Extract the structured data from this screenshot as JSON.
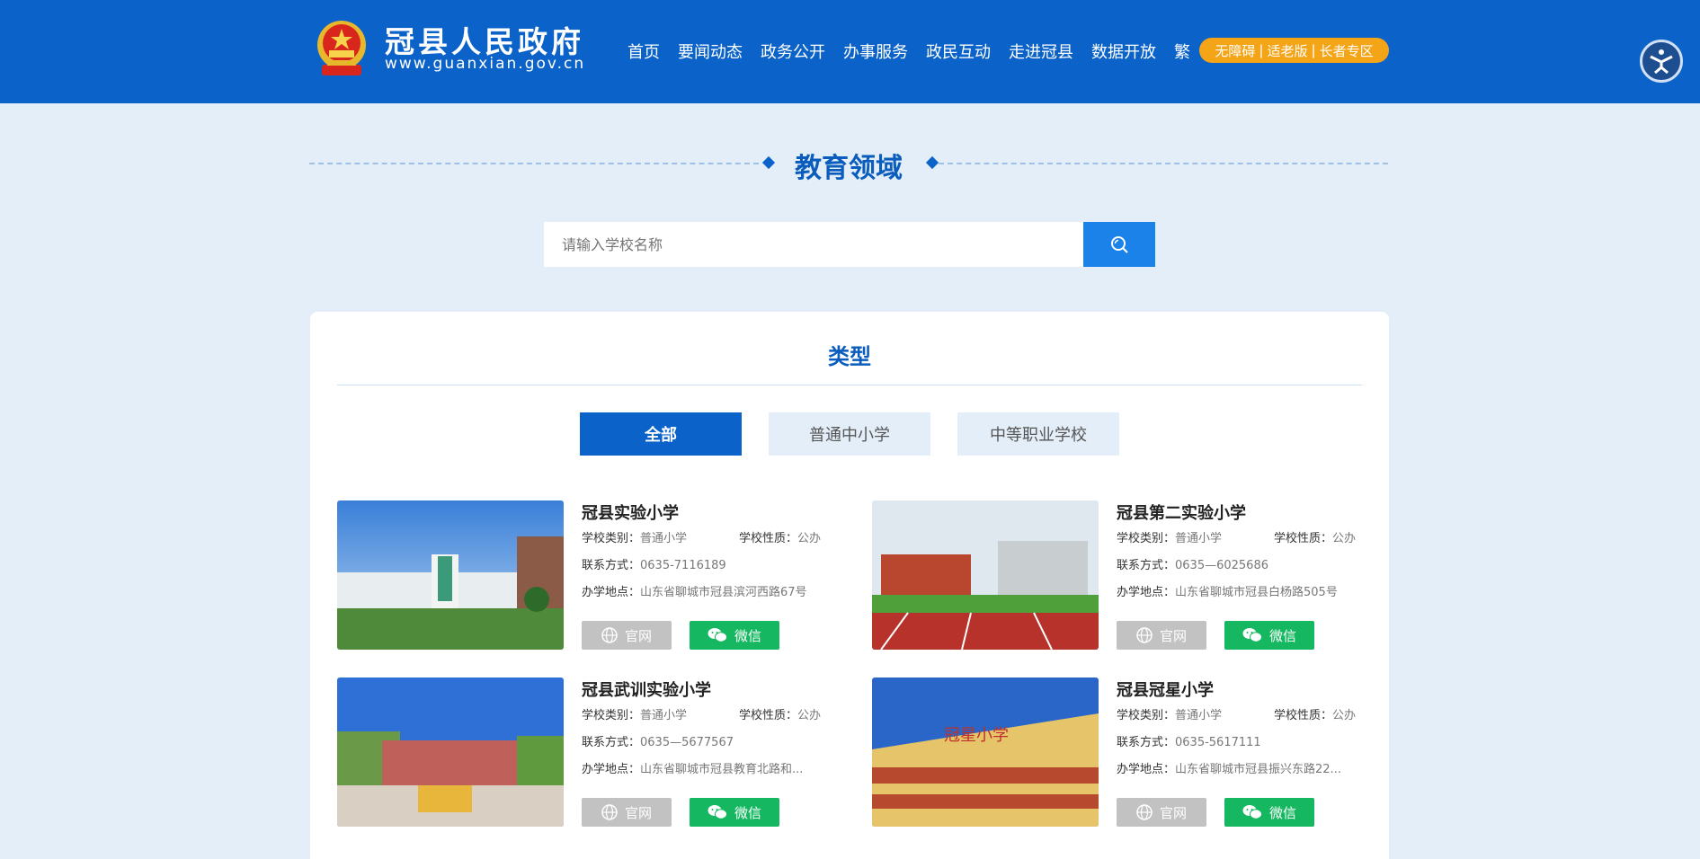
{
  "header": {
    "site_title": "冠县人民政府",
    "site_domain": "www.guanxian.gov.cn",
    "nav": [
      "首页",
      "要闻动态",
      "政务公开",
      "办事服务",
      "政民互动",
      "走进冠县",
      "数据开放",
      "繁"
    ],
    "accessibility": [
      "无障碍",
      "适老版",
      "长者专区"
    ],
    "separator": "|"
  },
  "section": {
    "title": "教育领域"
  },
  "search": {
    "placeholder": "请输入学校名称"
  },
  "panel": {
    "title": "类型",
    "tabs": [
      "全部",
      "普通中小学",
      "中等职业学校"
    ],
    "active_tab": "全部"
  },
  "labels": {
    "category": "学校类别：",
    "nature": "学校性质：",
    "contact": "联系方式：",
    "address": "办学地点：",
    "website": "官网",
    "wechat": "微信"
  },
  "schools": [
    {
      "name": "冠县实验小学",
      "category": "普通小学",
      "nature": "公办",
      "contact": "0635-7116189",
      "address": "山东省聊城市冠县滨河西路67号"
    },
    {
      "name": "冠县第二实验小学",
      "category": "普通小学",
      "nature": "公办",
      "contact": "0635—6025686",
      "address": "山东省聊城市冠县白杨路505号"
    },
    {
      "name": "冠县武训实验小学",
      "category": "普通小学",
      "nature": "公办",
      "contact": "0635—5677567",
      "address": "山东省聊城市冠县教育北路和..."
    },
    {
      "name": "冠县冠星小学",
      "category": "普通小学",
      "nature": "公办",
      "contact": "0635-5617111",
      "address": "山东省聊城市冠县振兴东路22..."
    }
  ],
  "colors": {
    "primary": "#0b63c9",
    "accent": "#f4a417",
    "wechat": "#15b860",
    "background": "#e3eef9"
  }
}
